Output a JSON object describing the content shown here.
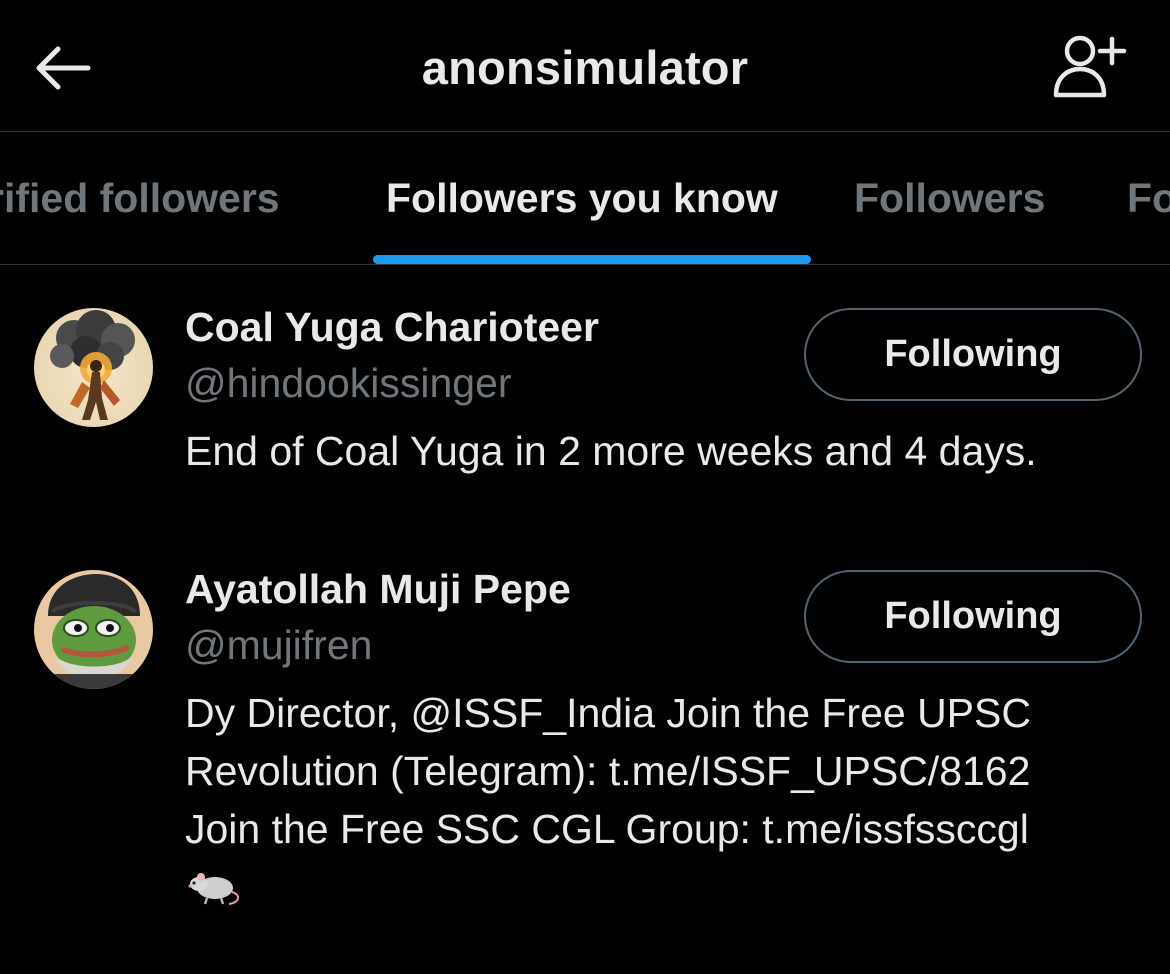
{
  "header": {
    "title": "anonsimulator",
    "back_icon": "back-arrow-icon",
    "add_user_icon": "add-user-icon"
  },
  "tabs": [
    {
      "label": "rified followers",
      "active": false
    },
    {
      "label": "Followers you know",
      "active": true
    },
    {
      "label": "Followers",
      "active": false
    },
    {
      "label": "Fo",
      "active": false
    }
  ],
  "colors": {
    "accent": "#1d9bf0",
    "background": "#000000",
    "secondary_text": "#71767b",
    "primary_text": "#e7e9ea"
  },
  "users": [
    {
      "name": "Coal Yuga Charioteer",
      "handle": "@hindookissinger",
      "bio_lines": [
        "End of Coal Yuga in 2 more weeks and 4 days."
      ],
      "button_label": "Following"
    },
    {
      "name": "Ayatollah Muji Pepe",
      "handle": "@mujifren",
      "bio_lines": [
        "Dy Director, @ISSF_India Join the Free UPSC",
        "Revolution (Telegram): t.me/ISSF_UPSC/8162",
        "Join the Free SSC CGL Group: t.me/issfssccgl"
      ],
      "bio_emoji": "rat-emoji",
      "button_label": "Following"
    }
  ]
}
